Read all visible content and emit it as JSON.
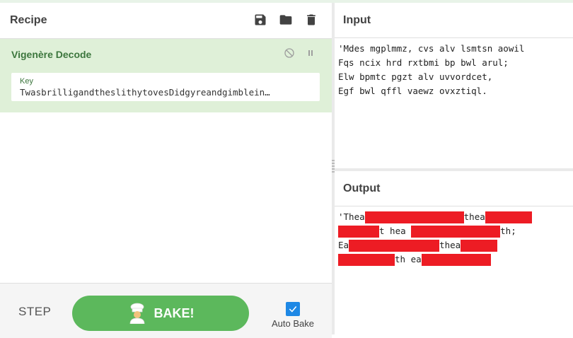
{
  "recipe": {
    "title": "Recipe",
    "icons": [
      "save-icon",
      "folder-icon",
      "trash-icon"
    ],
    "operation": {
      "name": "Vigenère Decode",
      "key_label": "Key",
      "key_value": "TwasbrilligandtheslithytovesDidgyreandgimblein…"
    }
  },
  "controls": {
    "step_label": "STEP",
    "bake_label": "BAKE!",
    "autobake_label": "Auto Bake",
    "autobake_checked": true
  },
  "input": {
    "title": "Input",
    "lines": [
      "'Mdes mgplmmz, cvs alv lsmtsn aowil",
      "Fqs ncix hrd rxtbmi bp bwl arul;",
      "Elw bpmtc pgzt alv uvvordcet,",
      "Egf bwl qffl vaewz ovxztiql."
    ]
  },
  "output": {
    "title": "Output",
    "lines": [
      [
        {
          "t": "'Thea"
        },
        {
          "r": 140
        },
        {
          "t": "thea"
        },
        {
          "r": 66
        }
      ],
      [
        {
          "r": 58
        },
        {
          "t": "t hea "
        },
        {
          "r": 126
        },
        {
          "t": "th;"
        }
      ],
      [
        {
          "t": "Ea"
        },
        {
          "r": 128
        },
        {
          "t": "thea"
        },
        {
          "r": 52
        }
      ],
      [
        {
          "r": 80
        },
        {
          "t": "th ea"
        },
        {
          "r": 98
        }
      ]
    ]
  },
  "colors": {
    "accent_green": "#5cb85c",
    "operation_bg": "#dff0d8",
    "operation_text": "#3c763d",
    "redaction": "#ed1c24",
    "checkbox": "#1e88e5"
  }
}
